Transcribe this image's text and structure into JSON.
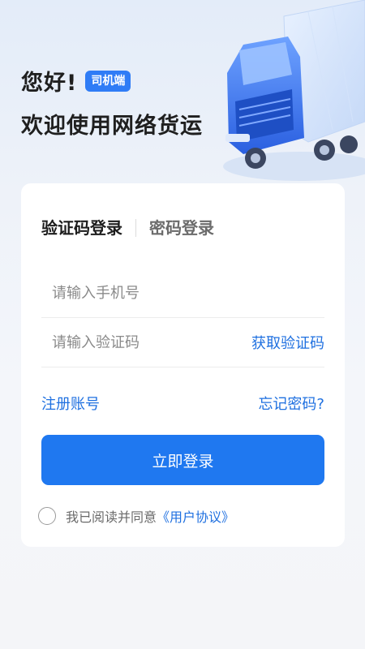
{
  "header": {
    "greeting": "您好!",
    "role_badge": "司机端",
    "welcome": "欢迎使用网络货运"
  },
  "tabs": [
    {
      "label": "验证码登录",
      "active": true
    },
    {
      "label": "密码登录",
      "active": false
    }
  ],
  "form": {
    "phone_placeholder": "请输入手机号",
    "phone_value": "",
    "code_placeholder": "请输入验证码",
    "code_value": "",
    "get_code_label": "获取验证码"
  },
  "links": {
    "register": "注册账号",
    "forgot": "忘记密码?"
  },
  "login_button": "立即登录",
  "agreement": {
    "checked": false,
    "text": "我已阅读并同意",
    "link": "《用户协议》"
  },
  "colors": {
    "accent": "#1f78f0",
    "badge": "#2f7cf6",
    "link": "#1f70e0"
  },
  "icons": {
    "hero": "truck-illustration",
    "checkbox": "radio-circle"
  }
}
